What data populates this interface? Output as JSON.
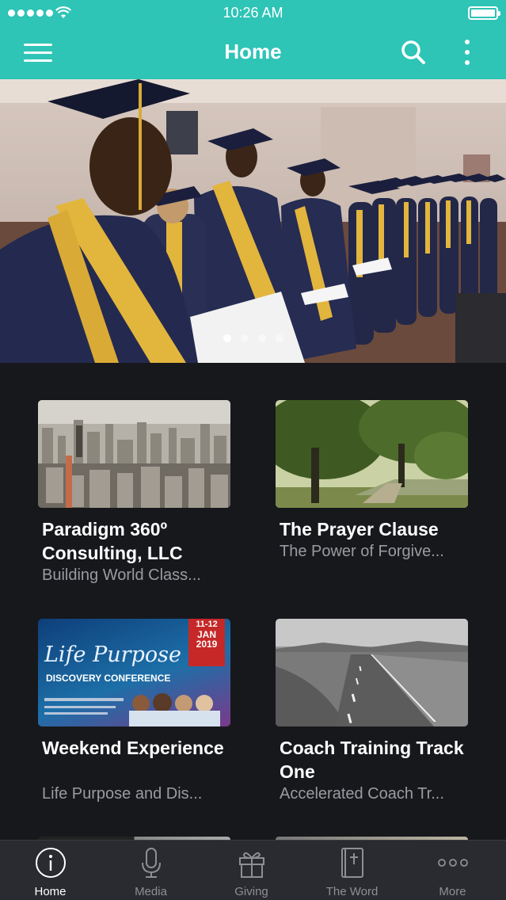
{
  "status": {
    "time": "10:26 AM"
  },
  "nav": {
    "title": "Home"
  },
  "hero": {
    "slides": 4,
    "active_slide": 1
  },
  "cards": [
    {
      "title": "Paradigm 360º Consulting, LLC",
      "subtitle": "Building World Class..."
    },
    {
      "title": "The Prayer Clause",
      "subtitle": "The Power of Forgive..."
    },
    {
      "title": "Weekend Experience",
      "subtitle": "Life Purpose and Dis..."
    },
    {
      "title": "Coach Training Track One",
      "subtitle": "Accelerated Coach Tr..."
    }
  ],
  "poster": {
    "date_range": "11-12",
    "month": "JAN",
    "year": "2019",
    "heading": "Life Purpose",
    "subheading": "DISCOVERY CONFERENCE"
  },
  "tabs": [
    {
      "label": "Home",
      "icon": "info-icon",
      "active": true
    },
    {
      "label": "Media",
      "icon": "microphone-icon",
      "active": false
    },
    {
      "label": "Giving",
      "icon": "gift-icon",
      "active": false
    },
    {
      "label": "The Word",
      "icon": "bible-icon",
      "active": false
    },
    {
      "label": "More",
      "icon": "more-dots-icon",
      "active": false
    }
  ],
  "colors": {
    "header": "#2ec4b6",
    "background": "#17181c",
    "tabbar": "#2a2b30",
    "accent_gold": "#e2b53d"
  }
}
